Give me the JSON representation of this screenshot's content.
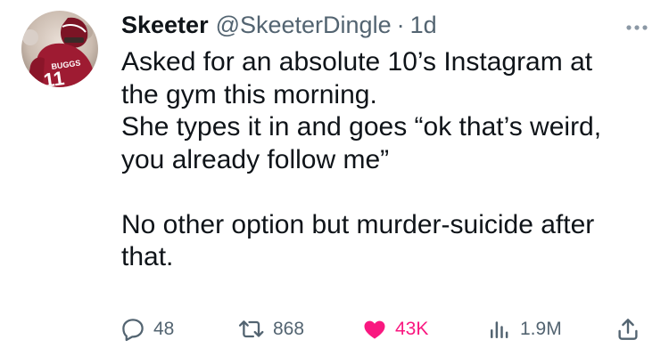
{
  "tweet": {
    "author_name": "Skeeter",
    "handle": "@SkeeterDingle",
    "separator": "·",
    "time": "1d",
    "body_lines": [
      "Asked for an absolute 10’s Instagram at",
      "the gym this morning.",
      "She types it in and goes “ok that’s weird,",
      "you already follow me”",
      "",
      "No other option but murder-suicide after",
      "that."
    ],
    "avatar_jersey_text": "11",
    "avatar_name_text": "BUGGS"
  },
  "actions": {
    "replies": "48",
    "retweets": "868",
    "likes": "43K",
    "views": "1.9M"
  },
  "icons": {
    "more": "more-horizontal-icon",
    "reply": "reply-bubble-icon",
    "retweet": "retweet-arrows-icon",
    "like": "heart-filled-icon",
    "views": "bar-chart-icon",
    "share": "share-upload-icon"
  },
  "colors": {
    "text": "#0f1419",
    "secondary": "#536471",
    "like_active": "#f91880",
    "jersey": "#9e1b32"
  }
}
